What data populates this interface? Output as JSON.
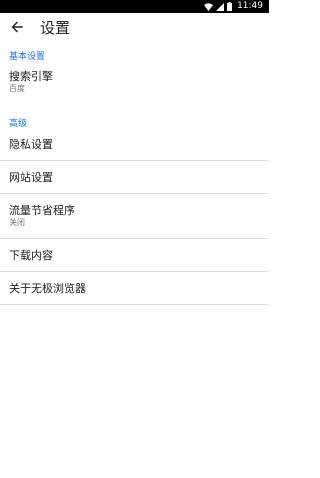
{
  "status_bar": {
    "time": "11:49",
    "icons": [
      "wifi-icon",
      "signal-icon",
      "battery-icon"
    ]
  },
  "app_bar": {
    "back_icon": "back-arrow-icon",
    "title": "设置"
  },
  "sections": {
    "basic": {
      "header": "基本设置"
    },
    "advanced": {
      "header": "高级"
    }
  },
  "items": {
    "search_engine": {
      "label": "搜索引擎",
      "value": "百度"
    },
    "privacy": {
      "label": "隐私设置"
    },
    "site_settings": {
      "label": "网站设置"
    },
    "data_saver": {
      "label": "流量节省程序",
      "value": "关闭"
    },
    "downloads": {
      "label": "下载内容"
    },
    "about": {
      "label": "关于无极浏览器"
    }
  }
}
